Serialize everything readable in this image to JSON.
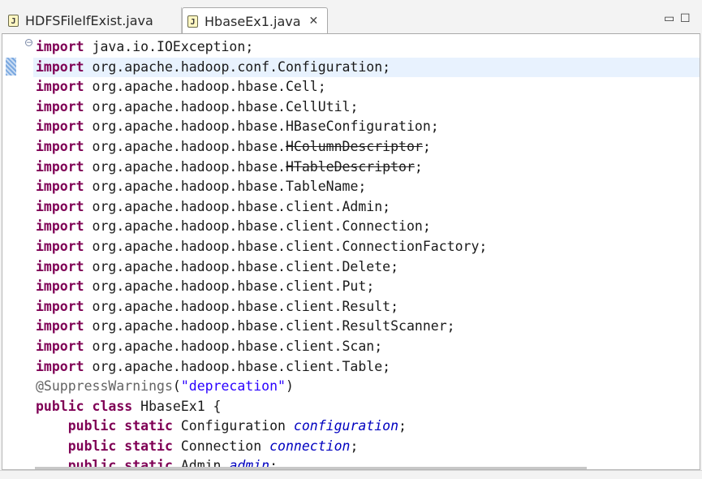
{
  "tabs": [
    {
      "label": "HDFSFileIfExist.java",
      "icon": "java-file-icon",
      "active": false
    },
    {
      "label": "HbaseEx1.java",
      "icon": "java-file-icon",
      "active": true
    }
  ],
  "window_controls": {
    "minimize": "▭",
    "maximize": "☐"
  },
  "code": {
    "imports": [
      {
        "pkg": "java.io.",
        "cls": "IOException",
        "deprecated": false
      },
      {
        "pkg": "org.apache.hadoop.conf.",
        "cls": "Configuration",
        "deprecated": false
      },
      {
        "pkg": "org.apache.hadoop.hbase.",
        "cls": "Cell",
        "deprecated": false
      },
      {
        "pkg": "org.apache.hadoop.hbase.",
        "cls": "CellUtil",
        "deprecated": false
      },
      {
        "pkg": "org.apache.hadoop.hbase.",
        "cls": "HBaseConfiguration",
        "deprecated": false
      },
      {
        "pkg": "org.apache.hadoop.hbase.",
        "cls": "HColumnDescriptor",
        "deprecated": true
      },
      {
        "pkg": "org.apache.hadoop.hbase.",
        "cls": "HTableDescriptor",
        "deprecated": true
      },
      {
        "pkg": "org.apache.hadoop.hbase.",
        "cls": "TableName",
        "deprecated": false
      },
      {
        "pkg": "org.apache.hadoop.hbase.client.",
        "cls": "Admin",
        "deprecated": false
      },
      {
        "pkg": "org.apache.hadoop.hbase.client.",
        "cls": "Connection",
        "deprecated": false
      },
      {
        "pkg": "org.apache.hadoop.hbase.client.",
        "cls": "ConnectionFactory",
        "deprecated": false
      },
      {
        "pkg": "org.apache.hadoop.hbase.client.",
        "cls": "Delete",
        "deprecated": false
      },
      {
        "pkg": "org.apache.hadoop.hbase.client.",
        "cls": "Put",
        "deprecated": false
      },
      {
        "pkg": "org.apache.hadoop.hbase.client.",
        "cls": "Result",
        "deprecated": false
      },
      {
        "pkg": "org.apache.hadoop.hbase.client.",
        "cls": "ResultScanner",
        "deprecated": false
      },
      {
        "pkg": "org.apache.hadoop.hbase.client.",
        "cls": "Scan",
        "deprecated": false
      },
      {
        "pkg": "org.apache.hadoop.hbase.client.",
        "cls": "Table",
        "deprecated": false
      }
    ],
    "import_keyword": "import",
    "annotation": "@SuppressWarnings",
    "annotation_arg": "\"deprecation\"",
    "class_decl": {
      "mods": "public class",
      "name": "HbaseEx1",
      "brace": "{"
    },
    "fields": [
      {
        "mods": "public static",
        "type": "Configuration",
        "name": "configuration"
      },
      {
        "mods": "public static",
        "type": "Connection",
        "name": "connection"
      },
      {
        "mods": "public static",
        "type": "Admin",
        "name": "admin"
      }
    ],
    "current_line": 1
  },
  "colors": {
    "keyword": "#7f0055",
    "string": "#2a00ff",
    "field": "#0000c0",
    "annotation": "#646464",
    "current_line": "#e8f2fe"
  }
}
